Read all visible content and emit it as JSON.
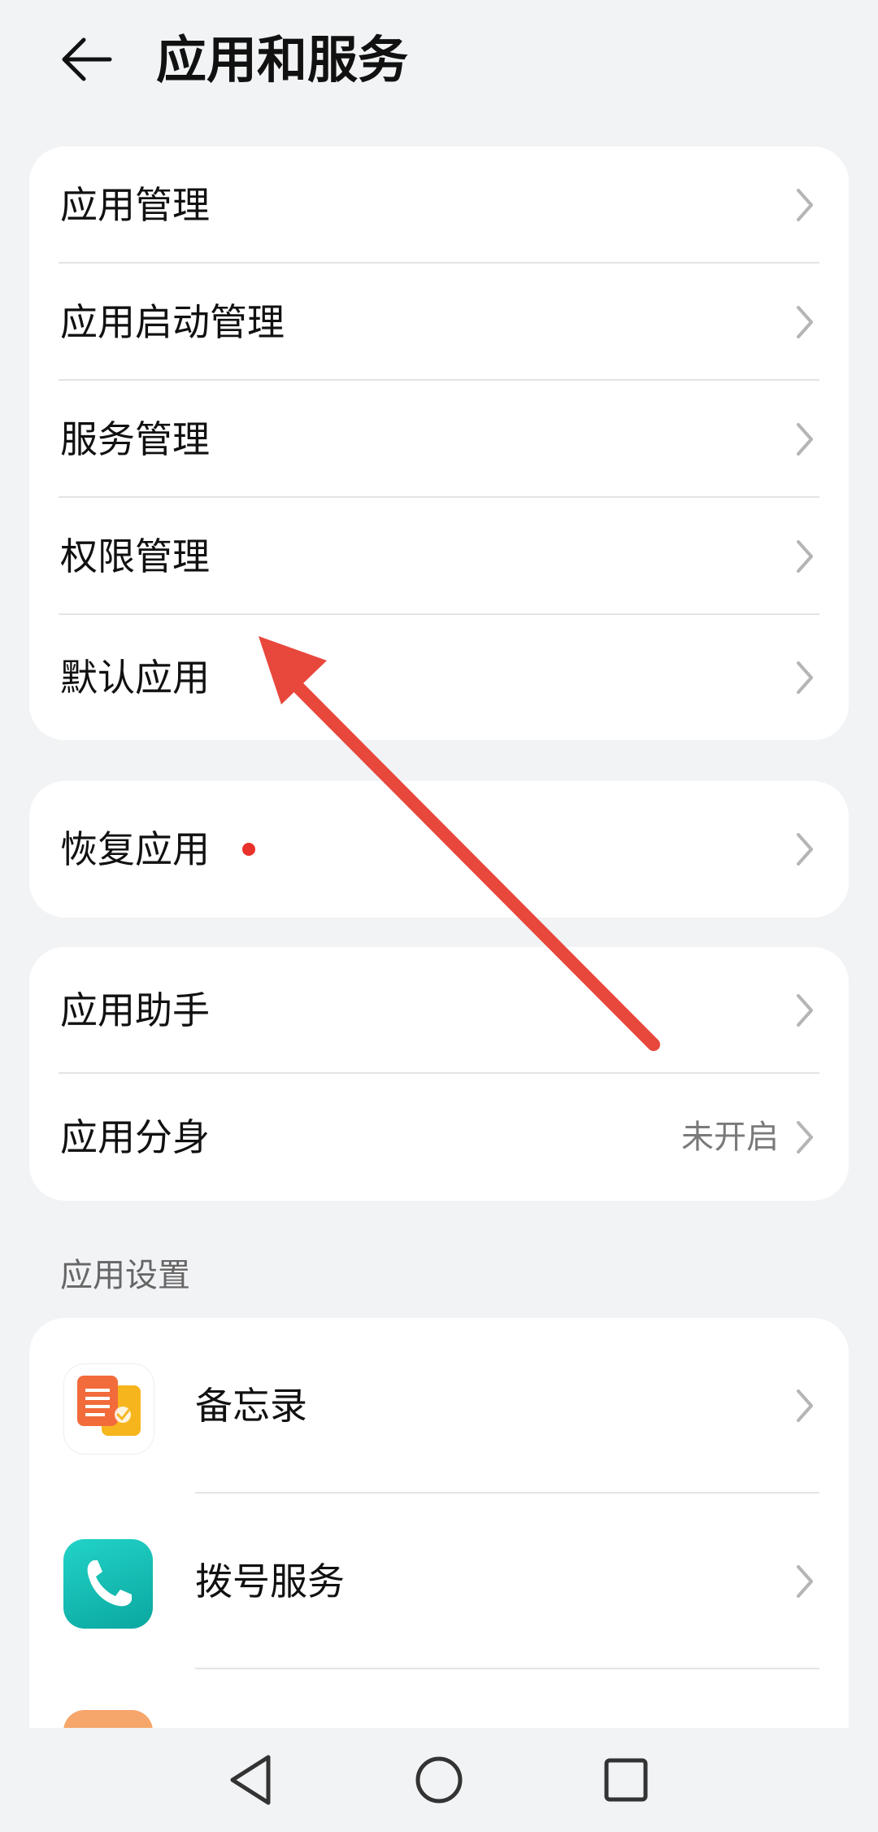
{
  "header": {
    "title": "应用和服务"
  },
  "group1": {
    "items": [
      {
        "label": "应用管理"
      },
      {
        "label": "应用启动管理"
      },
      {
        "label": "服务管理"
      },
      {
        "label": "权限管理"
      },
      {
        "label": "默认应用"
      }
    ]
  },
  "group2": {
    "items": [
      {
        "label": "恢复应用",
        "has_red_dot": true
      }
    ]
  },
  "group3": {
    "items": [
      {
        "label": "应用助手"
      },
      {
        "label": "应用分身",
        "value": "未开启"
      }
    ]
  },
  "app_settings": {
    "section_title": "应用设置",
    "items": [
      {
        "label": "备忘录",
        "icon": "notes-app-icon"
      },
      {
        "label": "拨号服务",
        "icon": "phone-app-icon"
      }
    ]
  },
  "colors": {
    "background": "#f1f3f5",
    "card": "#ffffff",
    "red_dot": "#e8312a",
    "annotation_arrow": "#e8473c"
  },
  "navbar": {
    "buttons": [
      "back-triangle-icon",
      "home-circle-icon",
      "recents-square-icon"
    ]
  }
}
